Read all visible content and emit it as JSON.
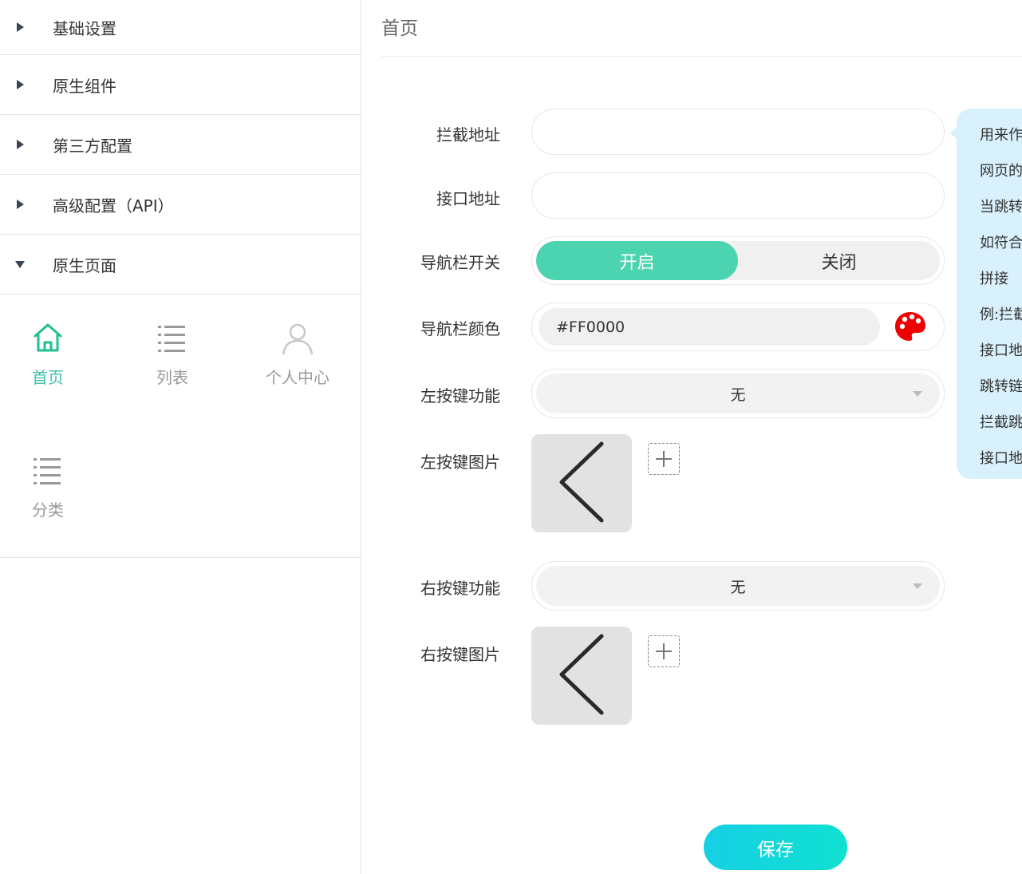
{
  "sidebar": {
    "menu": [
      {
        "label": "基础设置",
        "expanded": false
      },
      {
        "label": "原生组件",
        "expanded": false
      },
      {
        "label": "第三方配置",
        "expanded": false
      },
      {
        "label": "高级配置（API）",
        "expanded": false
      },
      {
        "label": "原生页面",
        "expanded": true
      }
    ],
    "pages": [
      {
        "label": "首页",
        "icon": "home-icon",
        "active": true
      },
      {
        "label": "列表",
        "icon": "list-icon",
        "active": false
      },
      {
        "label": "个人中心",
        "icon": "user-icon",
        "active": false
      },
      {
        "label": "分类",
        "icon": "list-icon",
        "active": false
      }
    ]
  },
  "main": {
    "title": "首页",
    "intercept_url": {
      "label": "拦截地址",
      "value": ""
    },
    "api_url": {
      "label": "接口地址",
      "value": ""
    },
    "nav_switch": {
      "label": "导航栏开关",
      "on_label": "开启",
      "off_label": "关闭",
      "selected": "开启"
    },
    "nav_color": {
      "label": "导航栏颜色",
      "value": "#FF0000",
      "icon": "palette-icon"
    },
    "left_func": {
      "label": "左按键功能",
      "value": "无"
    },
    "left_img": {
      "label": "左按键图片",
      "icon": "chevron-left-icon"
    },
    "right_func": {
      "label": "右按键功能",
      "value": "无"
    },
    "right_img": {
      "label": "右按键图片",
      "icon": "chevron-left-icon"
    },
    "save_label": "保存"
  },
  "tooltip": {
    "lines": [
      "用来作",
      "网页的",
      "当跳转",
      "如符合",
      "拼接",
      "例:拦截",
      "接口地",
      "跳转链",
      "拦截跳",
      "接口地"
    ]
  },
  "colors": {
    "accent": "#4cd4b0",
    "active_text": "#3cbfae",
    "tooltip_bg": "#d9f1fc",
    "save_gradient_start": "#16d0e4",
    "save_gradient_end": "#0fe0d0",
    "palette": "#ee0000"
  }
}
